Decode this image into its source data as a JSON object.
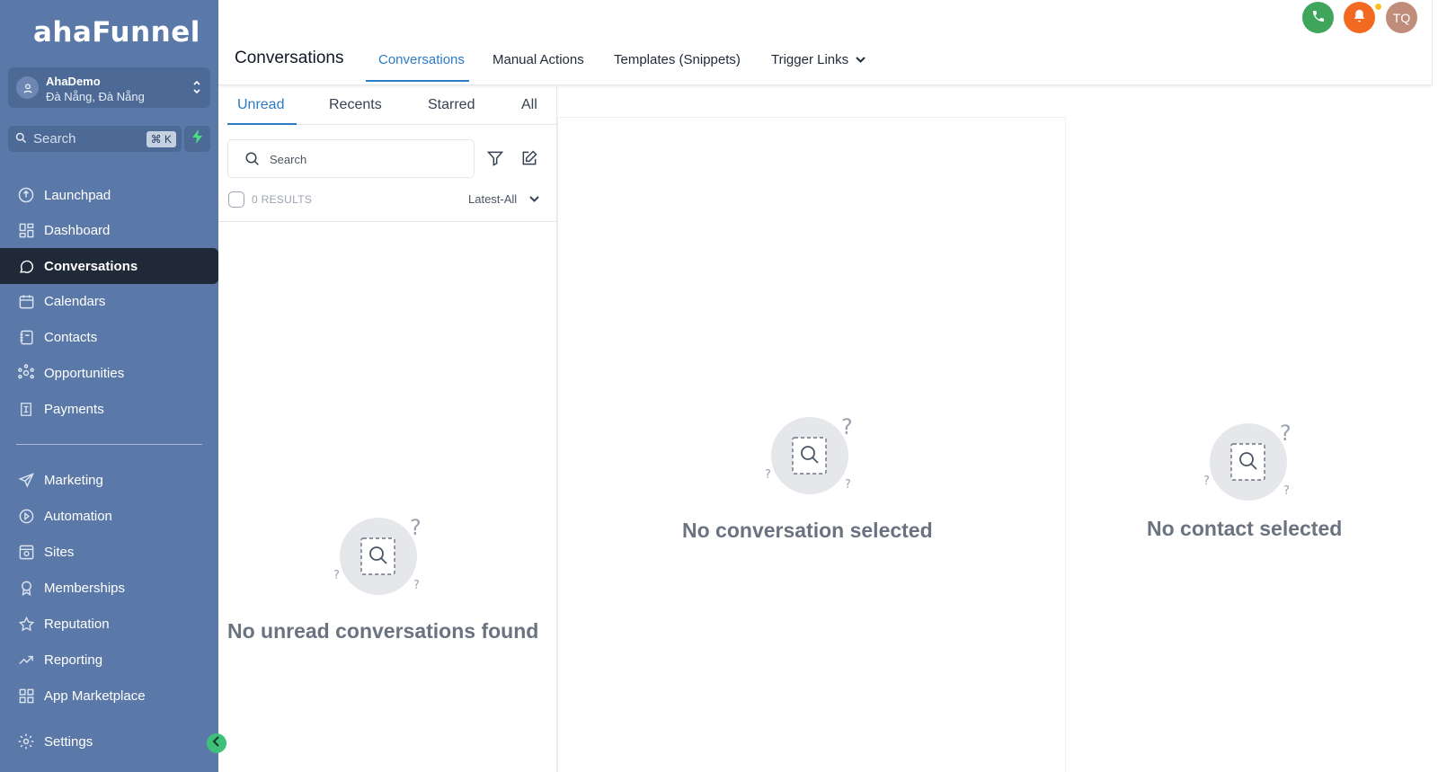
{
  "brand": {
    "logo_text": "ahaFunnel"
  },
  "account": {
    "name": "AhaDemo",
    "location": "Đà Nẵng, Đà Nẵng"
  },
  "sidebar_search": {
    "placeholder": "Search",
    "shortcut": "⌘ K"
  },
  "nav": {
    "launchpad": "Launchpad",
    "dashboard": "Dashboard",
    "conversations": "Conversations",
    "calendars": "Calendars",
    "contacts": "Contacts",
    "opportunities": "Opportunities",
    "payments": "Payments",
    "marketing": "Marketing",
    "automation": "Automation",
    "sites": "Sites",
    "memberships": "Memberships",
    "reputation": "Reputation",
    "reporting": "Reporting",
    "app_marketplace": "App Marketplace",
    "settings": "Settings"
  },
  "header": {
    "page_title": "Conversations",
    "tabs": [
      "Conversations",
      "Manual Actions",
      "Templates (Snippets)",
      "Trigger Links"
    ],
    "user_initials": "TQ"
  },
  "list": {
    "tabs": [
      "Unread",
      "Recents",
      "Starred",
      "All"
    ],
    "search_placeholder": "Search",
    "results": "0 RESULTS",
    "sort": "Latest-All",
    "empty": "No unread conversations found"
  },
  "conversation": {
    "empty": "No conversation selected"
  },
  "contact": {
    "empty": "No contact selected"
  },
  "colors": {
    "sidebar": "#5b79a8",
    "active_nav": "#1f2937",
    "accent": "#2b7bc5",
    "phone": "#3ea55b",
    "bell": "#f26a22",
    "avatar": "#c08d7b"
  }
}
